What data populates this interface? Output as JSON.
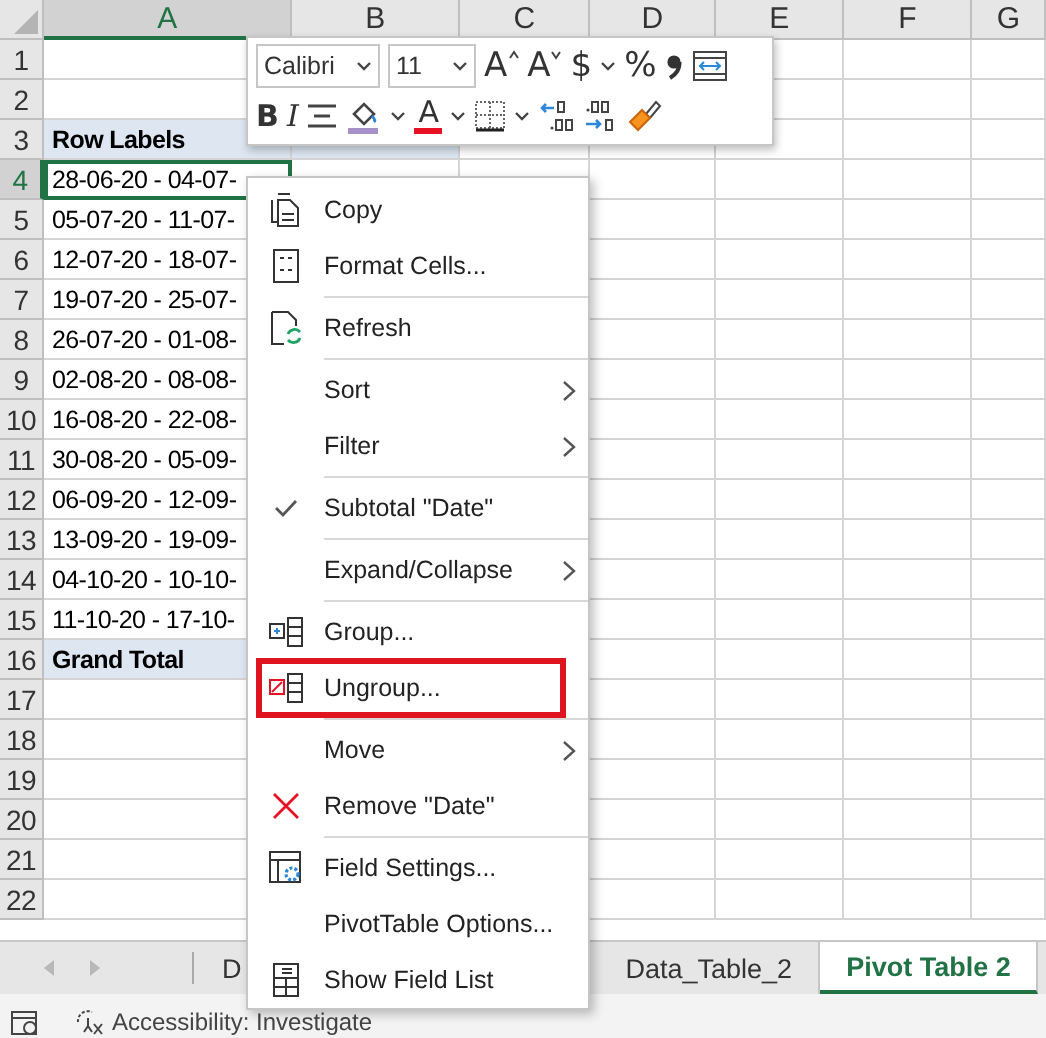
{
  "sheet": {
    "columns": [
      {
        "label": "A",
        "selected": true
      },
      {
        "label": "B",
        "selected": false
      },
      {
        "label": "C",
        "selected": false
      },
      {
        "label": "D",
        "selected": false
      },
      {
        "label": "E",
        "selected": false
      },
      {
        "label": "F",
        "selected": false
      },
      {
        "label": "G",
        "selected": false
      }
    ],
    "rows": [
      {
        "number": "1",
        "selected": false,
        "kind": "empty"
      },
      {
        "number": "2",
        "selected": false,
        "kind": "empty"
      },
      {
        "number": "3",
        "selected": false,
        "kind": "header",
        "value": "Row Labels"
      },
      {
        "number": "4",
        "selected": true,
        "kind": "item",
        "value": "28-06-20 - 04-07-"
      },
      {
        "number": "5",
        "selected": false,
        "kind": "item",
        "value": "05-07-20 - 11-07-"
      },
      {
        "number": "6",
        "selected": false,
        "kind": "item",
        "value": "12-07-20 - 18-07-"
      },
      {
        "number": "7",
        "selected": false,
        "kind": "item",
        "value": "19-07-20 - 25-07-"
      },
      {
        "number": "8",
        "selected": false,
        "kind": "item",
        "value": "26-07-20 - 01-08-"
      },
      {
        "number": "9",
        "selected": false,
        "kind": "item",
        "value": "02-08-20 - 08-08-"
      },
      {
        "number": "10",
        "selected": false,
        "kind": "item",
        "value": "16-08-20 - 22-08-"
      },
      {
        "number": "11",
        "selected": false,
        "kind": "item",
        "value": "30-08-20 - 05-09-"
      },
      {
        "number": "12",
        "selected": false,
        "kind": "item",
        "value": "06-09-20 - 12-09-"
      },
      {
        "number": "13",
        "selected": false,
        "kind": "item",
        "value": "13-09-20 - 19-09-"
      },
      {
        "number": "14",
        "selected": false,
        "kind": "item",
        "value": "04-10-20 - 10-10-"
      },
      {
        "number": "15",
        "selected": false,
        "kind": "item",
        "value": "11-10-20 - 17-10-"
      },
      {
        "number": "16",
        "selected": false,
        "kind": "total",
        "value": "Grand Total"
      },
      {
        "number": "17",
        "selected": false,
        "kind": "empty"
      },
      {
        "number": "18",
        "selected": false,
        "kind": "empty"
      },
      {
        "number": "19",
        "selected": false,
        "kind": "empty"
      },
      {
        "number": "20",
        "selected": false,
        "kind": "empty"
      },
      {
        "number": "21",
        "selected": false,
        "kind": "empty"
      },
      {
        "number": "22",
        "selected": false,
        "kind": "empty"
      }
    ]
  },
  "mini_toolbar": {
    "font_name": "Calibri",
    "font_size": "11",
    "row_1": [
      {
        "kind": "grow",
        "text": "A"
      },
      {
        "kind": "shrink",
        "text": "A"
      },
      {
        "kind": "glyph",
        "text": "$"
      },
      {
        "kind": "caret"
      },
      {
        "kind": "glyph",
        "text": "%"
      },
      {
        "kind": "comma"
      },
      {
        "kind": "wrap"
      }
    ],
    "row_2": [
      {
        "kind": "bold",
        "text": "B"
      },
      {
        "kind": "italic",
        "text": "I"
      },
      {
        "kind": "align"
      },
      {
        "kind": "fill"
      },
      {
        "kind": "caret"
      },
      {
        "kind": "fontcolor",
        "text": "A"
      },
      {
        "kind": "caret"
      },
      {
        "kind": "borders"
      },
      {
        "kind": "caret"
      },
      {
        "kind": "incdec"
      },
      {
        "kind": "decdec"
      },
      {
        "kind": "painter"
      }
    ]
  },
  "context_menu": [
    {
      "label": "Copy",
      "kind": "copy",
      "submenu": false,
      "checked": false,
      "highlighted": false,
      "separator_before": false
    },
    {
      "label": "Format Cells...",
      "kind": "format",
      "submenu": false,
      "checked": false,
      "highlighted": false,
      "separator_before": false
    },
    {
      "label": "Refresh",
      "kind": "refresh",
      "submenu": false,
      "checked": false,
      "highlighted": false,
      "separator_before": true
    },
    {
      "label": "Sort",
      "kind": "plain",
      "submenu": true,
      "checked": false,
      "highlighted": false,
      "separator_before": true
    },
    {
      "label": "Filter",
      "kind": "plain",
      "submenu": true,
      "checked": false,
      "highlighted": false,
      "separator_before": false
    },
    {
      "label": "Subtotal \"Date\"",
      "kind": "plain",
      "submenu": false,
      "checked": true,
      "highlighted": false,
      "separator_before": true
    },
    {
      "label": "Expand/Collapse",
      "kind": "plain",
      "submenu": true,
      "checked": false,
      "highlighted": false,
      "separator_before": true
    },
    {
      "label": "Group...",
      "kind": "group",
      "submenu": false,
      "checked": false,
      "highlighted": false,
      "separator_before": true
    },
    {
      "label": "Ungroup...",
      "kind": "ungroup",
      "submenu": false,
      "checked": false,
      "highlighted": true,
      "separator_before": false
    },
    {
      "label": "Move",
      "kind": "plain",
      "submenu": true,
      "checked": false,
      "highlighted": false,
      "separator_before": true
    },
    {
      "label": "Remove \"Date\"",
      "kind": "remove",
      "submenu": false,
      "checked": false,
      "highlighted": false,
      "separator_before": false
    },
    {
      "label": "Field Settings...",
      "kind": "settings",
      "submenu": false,
      "checked": false,
      "highlighted": false,
      "separator_before": true
    },
    {
      "label": "PivotTable Options...",
      "kind": "plain",
      "submenu": false,
      "checked": false,
      "highlighted": false,
      "separator_before": false
    },
    {
      "label": "Show Field List",
      "kind": "fieldlist",
      "submenu": false,
      "checked": false,
      "highlighted": false,
      "separator_before": false
    }
  ],
  "sheet_tabs": [
    {
      "label": "D",
      "selected": false
    },
    {
      "label": "Data_Table_2",
      "selected": false
    },
    {
      "label": "Pivot Table 2",
      "selected": true
    }
  ],
  "status_bar": {
    "accessibility": "Accessibility: Investigate"
  }
}
